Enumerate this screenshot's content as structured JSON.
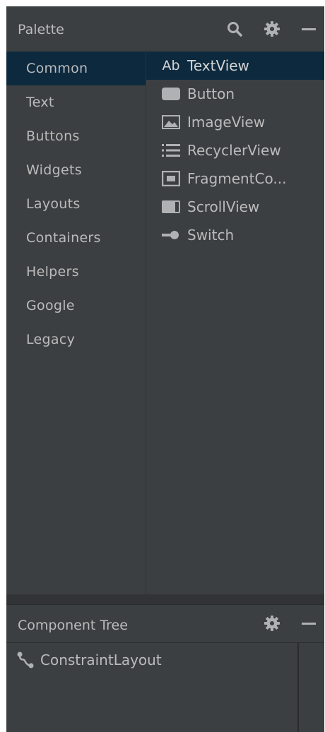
{
  "palette": {
    "title": "Palette",
    "header_icons": [
      "search-icon",
      "gear-icon",
      "minimize-icon"
    ],
    "categories": [
      {
        "label": "Common",
        "selected": true
      },
      {
        "label": "Text"
      },
      {
        "label": "Buttons"
      },
      {
        "label": "Widgets"
      },
      {
        "label": "Layouts"
      },
      {
        "label": "Containers"
      },
      {
        "label": "Helpers"
      },
      {
        "label": "Google"
      },
      {
        "label": "Legacy"
      }
    ],
    "items": [
      {
        "label": "TextView",
        "icon_text": "Ab",
        "icon": "textview-icon",
        "selected": true
      },
      {
        "label": "Button",
        "icon": "button-icon"
      },
      {
        "label": "ImageView",
        "icon": "image-icon"
      },
      {
        "label": "RecyclerView",
        "icon": "list-icon"
      },
      {
        "label": "FragmentCo...",
        "icon": "fragment-icon"
      },
      {
        "label": "ScrollView",
        "icon": "scrollview-icon"
      },
      {
        "label": "Switch",
        "icon": "switch-icon"
      }
    ]
  },
  "component_tree": {
    "title": "Component Tree",
    "header_icons": [
      "gear-icon",
      "minimize-icon"
    ],
    "nodes": [
      {
        "label": "ConstraintLayout",
        "icon": "constraint-layout-icon"
      }
    ]
  },
  "colors": {
    "panel_bg": "#3c3f41",
    "selection_bg": "#0d293e",
    "text": "#bbbbbb",
    "icon": "#afb1b3"
  }
}
